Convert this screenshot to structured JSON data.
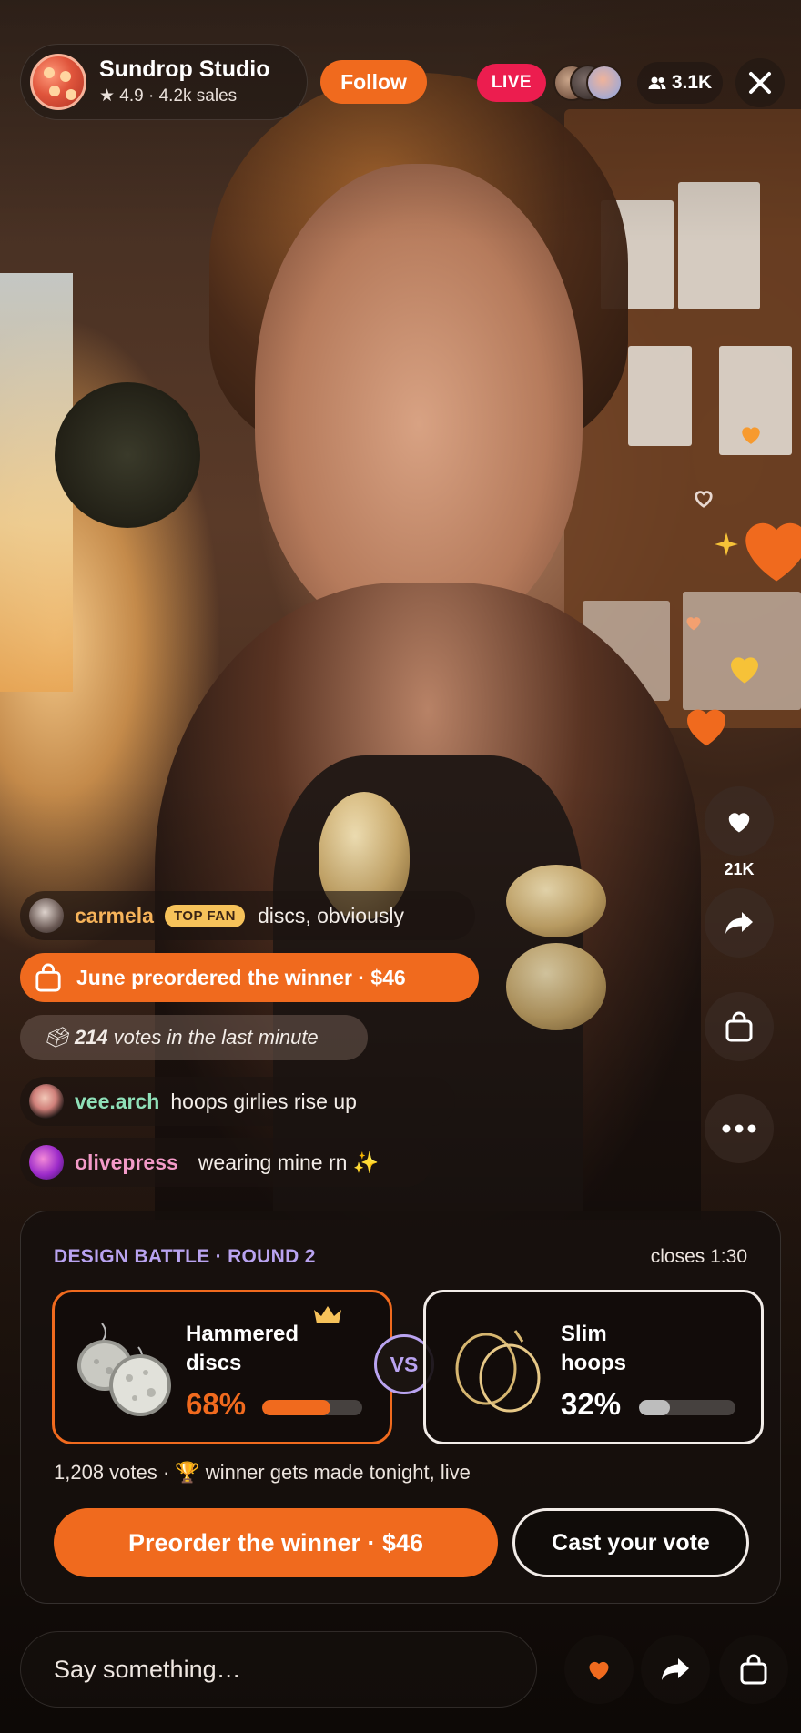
{
  "host": {
    "name": "Sundrop Studio",
    "rating": "★ 4.9 · 4.2k sales",
    "follow_label": "Follow"
  },
  "live_label": "LIVE",
  "viewer_count": "3.1K",
  "rail": {
    "like_count": "21K"
  },
  "comments": [
    {
      "user": "carmela",
      "badge": "TOP FAN",
      "text": "discs, obviously",
      "user_color": "#f6b35a"
    },
    {
      "user": "vee.arch",
      "text": "hoops girlies rise up",
      "user_color": "#8fe0b8"
    },
    {
      "user": "olivepress",
      "text": "wearing mine rn ✨",
      "user_color": "#f39ac8"
    }
  ],
  "preorder_toast": "June preordered the winner · $46",
  "votes_minute": {
    "emoji": "🗳",
    "count": "214",
    "text": "votes in the last minute"
  },
  "battle": {
    "title": "DESIGN BATTLE · ROUND 2",
    "closes": "closes 1:30",
    "vs_label": "VS",
    "options": [
      {
        "name_line1": "Hammered",
        "name_line2": "discs",
        "percent_label": "68%",
        "share": 0.68,
        "color": "#f06a1e"
      },
      {
        "name_line1": "Slim",
        "name_line2": "hoops",
        "percent_label": "32%",
        "share": 0.32,
        "color": "#bdbdbd"
      }
    ],
    "footer": "1,208 votes · 🏆 winner gets made tonight, live",
    "preorder_button": "Preorder the winner · $46",
    "vote_button": "Cast your vote"
  },
  "composer": {
    "placeholder": "Say something…"
  },
  "colors": {
    "accent": "#f06a1e",
    "live": "#ec1d4f",
    "battle_purple": "#b9a3f0"
  }
}
